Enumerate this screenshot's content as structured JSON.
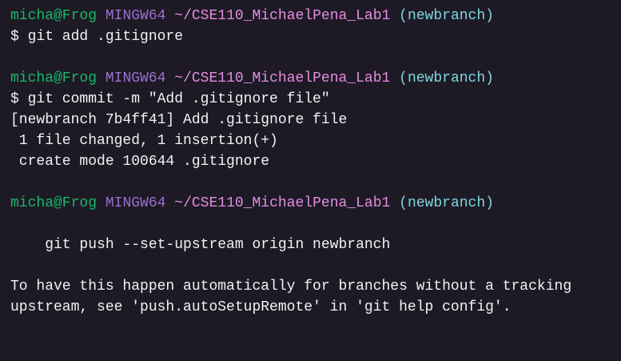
{
  "prompt": {
    "user": "micha@Frog",
    "system": "MINGW64",
    "path": "~/CSE110_MichaelPena_Lab1",
    "branch": "(newbranch)"
  },
  "lines": [
    "$ git add .gitignore",
    "",
    "$ git commit -m \"Add .gitignore file\"",
    "[newbranch 7b4ff41] Add .gitignore file",
    " 1 file changed, 1 insertion(+)",
    " create mode 100644 .gitignore",
    "",
    "",
    "    git push --set-upstream origin newbranch",
    "",
    "To have this happen automatically for branches without a tracking",
    "upstream, see 'push.autoSetupRemote' in 'git help config'."
  ]
}
